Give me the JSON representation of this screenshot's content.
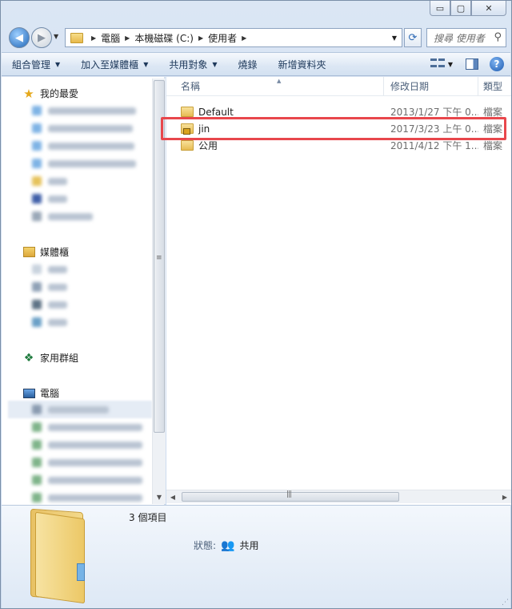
{
  "window": {
    "caption": {
      "minimize": "▭",
      "maximize": "▢",
      "close": "✕"
    }
  },
  "address": {
    "crumbs": [
      "電腦",
      "本機磁碟 (C:)",
      "使用者"
    ],
    "search_placeholder": "搜尋 使用者"
  },
  "toolbar": {
    "organize": "組合管理",
    "include_library": "加入至媒體櫃",
    "share_with": "共用對象",
    "burn": "燒錄",
    "new_folder": "新增資料夾"
  },
  "navpane": {
    "favorites": "我的最愛",
    "libraries": "媒體櫃",
    "homegroup": "家用群組",
    "computer": "電腦"
  },
  "filelist": {
    "columns": {
      "name": "名稱",
      "date": "修改日期",
      "type": "類型"
    },
    "rows": [
      {
        "name": "Default",
        "date": "2013/1/27 下午 0...",
        "type": "檔案",
        "icon": "folder-icon",
        "locked": false
      },
      {
        "name": "jin",
        "date": "2017/3/23 上午 0...",
        "type": "檔案",
        "icon": "locked-folder-icon",
        "locked": true
      },
      {
        "name": "公用",
        "date": "2011/4/12 下午 1...",
        "type": "檔案",
        "icon": "folder-icon",
        "locked": false
      }
    ]
  },
  "details": {
    "item_count": "3 個項目",
    "status_label": "狀態:",
    "status_value": "共用"
  },
  "colors": {
    "highlight": "#e8474c",
    "accent": "#1d5bb0"
  }
}
